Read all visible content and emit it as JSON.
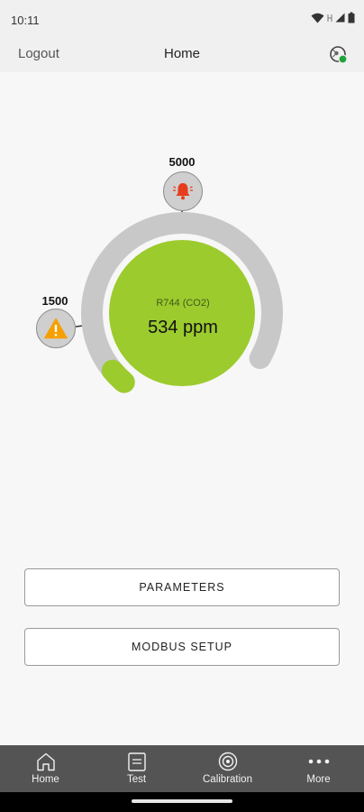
{
  "status_bar": {
    "time": "10:11"
  },
  "header": {
    "logout_label": "Logout",
    "title": "Home"
  },
  "gauge": {
    "gas_name": "R744 (CO2)",
    "reading": "534 ppm",
    "alarm_high_threshold": "5000",
    "alarm_low_threshold": "1500",
    "level_fraction": 0.04,
    "colors": {
      "track": "#c8c8c8",
      "fill": "#9ccb2e",
      "alarm_icon": "#e63d1c",
      "warning_icon": "#f5a000"
    }
  },
  "actions": {
    "parameters_label": "PARAMETERS",
    "modbus_label": "MODBUS SETUP"
  },
  "bottom_nav": {
    "items": [
      {
        "label": "Home",
        "icon": "home-icon"
      },
      {
        "label": "Test",
        "icon": "test-icon"
      },
      {
        "label": "Calibration",
        "icon": "calibration-icon"
      },
      {
        "label": "More",
        "icon": "more-icon"
      }
    ]
  }
}
